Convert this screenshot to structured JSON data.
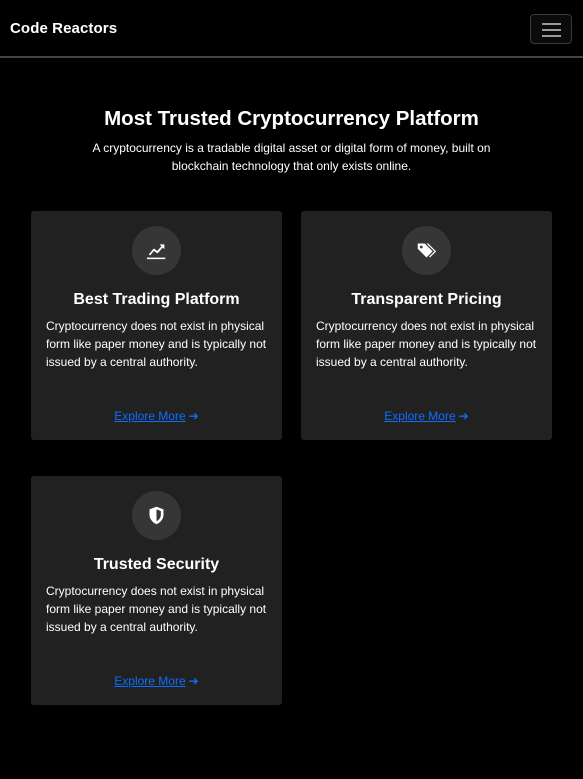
{
  "navbar": {
    "brand": "Code Reactors",
    "toggler_icon": "hamburger-menu-icon"
  },
  "hero": {
    "title": "Most Trusted Cryptocurrency Platform",
    "subtitle": "A cryptocurrency is a tradable digital asset or digital form of money, built on blockchain technology that only exists online."
  },
  "features": [
    {
      "icon": "chart-line-icon",
      "title": "Best Trading Platform",
      "text": "Cryptocurrency does not exist in physical form like paper money and is typically not issued by a central authority.",
      "link": "Explore More",
      "link_icon": "arrow-right-icon"
    },
    {
      "icon": "tags-icon",
      "title": "Transparent Pricing",
      "text": "Cryptocurrency does not exist in physical form like paper money and is typically not issued by a central authority.",
      "link": "Explore More",
      "link_icon": "arrow-right-icon"
    },
    {
      "icon": "shield-icon",
      "title": "Trusted Security",
      "text": "Cryptocurrency does not exist in physical form like paper money and is typically not issued by a central authority.",
      "link": "Explore More",
      "link_icon": "arrow-right-icon"
    }
  ],
  "colors": {
    "background": "#000000",
    "card": "#212121",
    "icon_circle": "#363636",
    "link": "#0d6efd"
  }
}
